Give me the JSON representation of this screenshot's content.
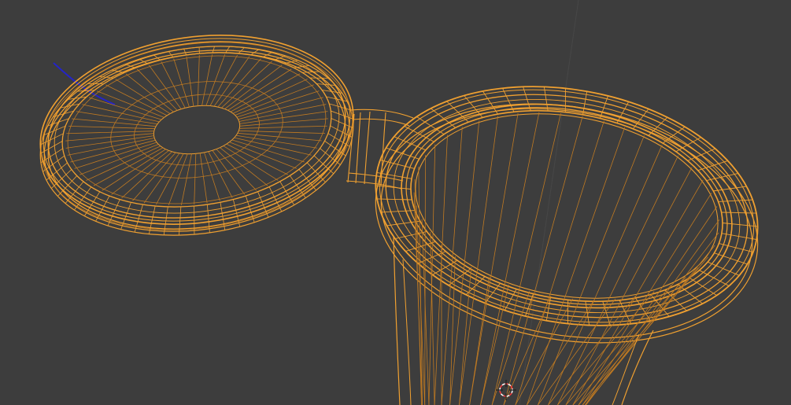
{
  "viewport": {
    "background_color": "#3d3d3d",
    "wire_color": "#f0a030",
    "wire_color_dim": "#c07a22",
    "axis_color": "#2020c8",
    "cursor_colors": [
      "#ff3b3b",
      "#ffffff"
    ]
  },
  "objects": [
    {
      "name": "lid",
      "selected": true
    },
    {
      "name": "hinge",
      "selected": true
    },
    {
      "name": "cup",
      "selected": true
    }
  ],
  "icons": {
    "cursor": "3d-cursor-icon",
    "axis": "z-axis-line"
  }
}
